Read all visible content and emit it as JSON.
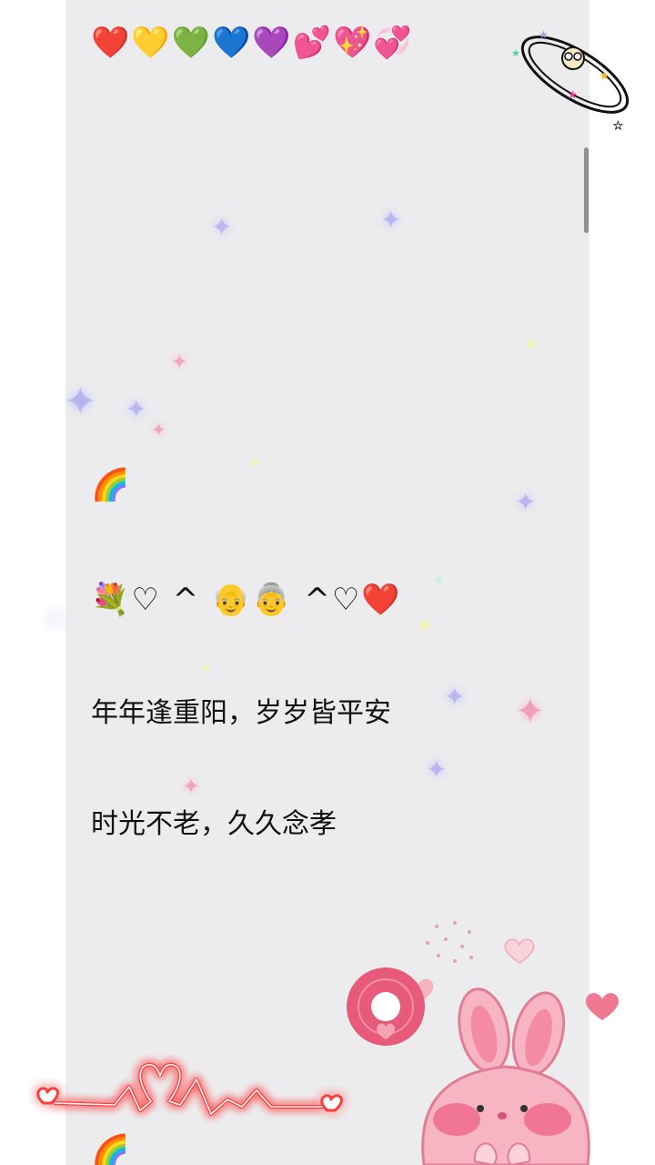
{
  "note": {
    "hearts_row": "❤️💛💚💙💜💕💖💞",
    "rainbow_1": "🌈",
    "family_row": "💐♡ ^ 👴👵 ^♡❤️",
    "line_1": "年年逢重阳，岁岁皆平安",
    "line_2": "时光不老，久久念孝",
    "rainbow_2": "🌈"
  },
  "stickers": {
    "orbit": "planet-ring-icon",
    "record": "vinyl-record-icon",
    "neon_heartbeat": "heartbeat-line-icon",
    "bunny": "pink-bunny-icon"
  },
  "colors": {
    "panel_background": "#ececee",
    "text": "#111111",
    "pink_accent": "#e85a7a",
    "neon_red": "#ff3b3b"
  }
}
